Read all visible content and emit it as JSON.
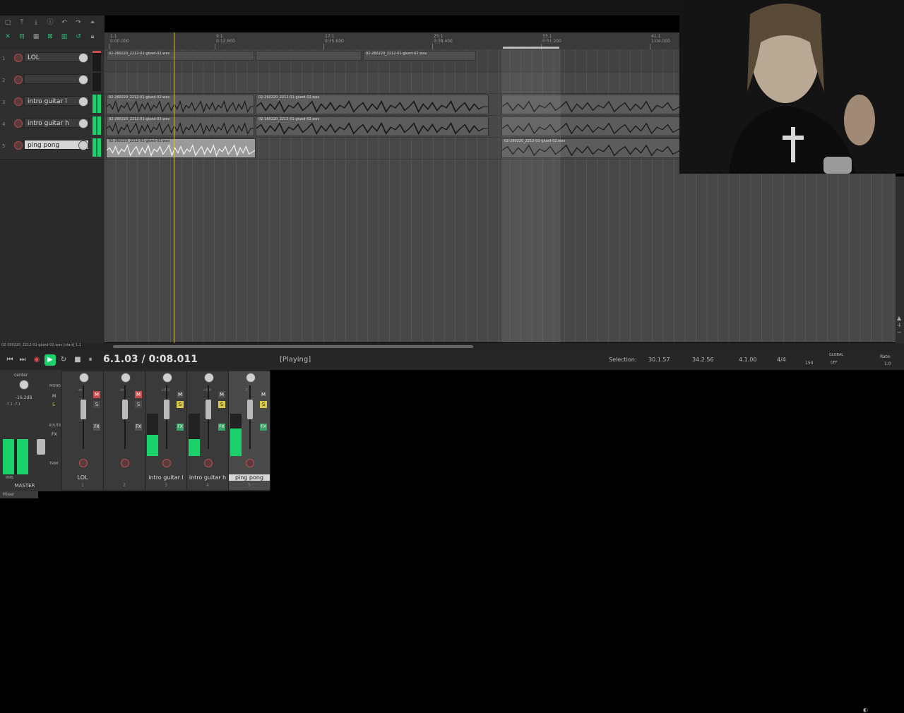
{
  "colors": {
    "accent": "#1bd16b",
    "record": "#c94a4a",
    "playhead": "#d8c060",
    "solo": "#d8c64a"
  },
  "ruler": {
    "marks": [
      {
        "bar": "1.1",
        "time": "0:00.000"
      },
      {
        "bar": "9.1",
        "time": "0:12.800"
      },
      {
        "bar": "17.1",
        "time": "0:25.600"
      },
      {
        "bar": "25.1",
        "time": "0:38.400"
      },
      {
        "bar": "33.1",
        "time": "0:51.200"
      },
      {
        "bar": "41.1",
        "time": "1:04.000"
      }
    ]
  },
  "tracks": [
    {
      "num": "1",
      "name": "LOL"
    },
    {
      "num": "2",
      "name": ""
    },
    {
      "num": "3",
      "name": "intro guitar l"
    },
    {
      "num": "4",
      "name": "intro guitar h"
    },
    {
      "num": "5",
      "name": "ping pong"
    }
  ],
  "item_label": "02-260220_2212-01-glued-02.wav",
  "status_file": "02-260220_2212-01-glued-02.wav [start] 1.1",
  "transport": {
    "position": "6.1.03 / 0:08.011",
    "state": "[Playing]",
    "selection_label": "Selection:",
    "selection_start": "30.1.57",
    "selection_end": "34.2.56",
    "selection_length": "4.1.00",
    "time_sig": "4/4",
    "bpm": "150",
    "global": "GLOBAL",
    "global_state": "OFF",
    "rate_label": "Rate:",
    "rate": "1.0"
  },
  "mixer": {
    "master": {
      "name": "MASTER",
      "pan": "center",
      "level": "-16.2dB",
      "peaks": "-7.1  -7.1",
      "rms": "RMS"
    },
    "strips": [
      {
        "name": "LOL",
        "num": "1",
        "mute": "M",
        "solo": "S",
        "level": "-inf"
      },
      {
        "name": "",
        "num": "2",
        "mute": "M",
        "solo": "S",
        "level": "-inf"
      },
      {
        "name": "intro guitar l",
        "num": "3",
        "mute": "M",
        "solo": "S",
        "level": "+0.0"
      },
      {
        "name": "intro guitar h",
        "num": "4",
        "mute": "M",
        "solo": "S",
        "level": "+0.0"
      },
      {
        "name": "ping pong",
        "num": "5",
        "mute": "M",
        "solo": "S",
        "level": "-7.4"
      }
    ],
    "master_buttons": {
      "mono": "MONO",
      "m": "M",
      "s": "S",
      "fx": "FX",
      "route": "ROUTE",
      "trim": "TRIM"
    }
  },
  "mixer_tab": "Mixer"
}
